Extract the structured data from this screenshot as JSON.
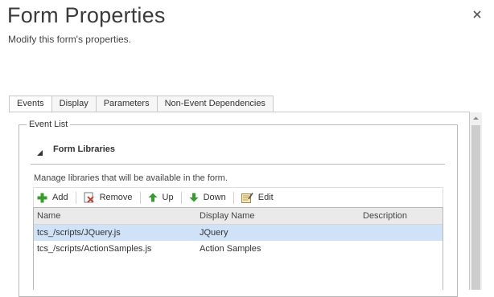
{
  "dialog": {
    "title": "Form Properties",
    "subtitle": "Modify this form's properties.",
    "close_icon": "close-icon"
  },
  "tabs": [
    {
      "label": "Events",
      "active": true
    },
    {
      "label": "Display",
      "active": false
    },
    {
      "label": "Parameters",
      "active": false
    },
    {
      "label": "Non-Event Dependencies",
      "active": false
    }
  ],
  "event_list": {
    "legend": "Event List",
    "section_title": "Form Libraries",
    "description": "Manage libraries that will be available in the form.",
    "toolbar": {
      "add": "Add",
      "remove": "Remove",
      "up": "Up",
      "down": "Down",
      "edit": "Edit"
    },
    "columns": [
      "Name",
      "Display Name",
      "Description"
    ],
    "rows": [
      {
        "name": "tcs_/scripts/JQuery.js",
        "display_name": "JQuery",
        "description": "",
        "selected": true
      },
      {
        "name": "tcs_/scripts/ActionSamples.js",
        "display_name": "Action Samples",
        "description": "",
        "selected": false
      }
    ]
  },
  "colors": {
    "selected_row": "#cfe2f7",
    "add_icon": "#3a9b2e",
    "remove_icon": "#c0392b",
    "arrow_icon": "#3a9b2e"
  }
}
